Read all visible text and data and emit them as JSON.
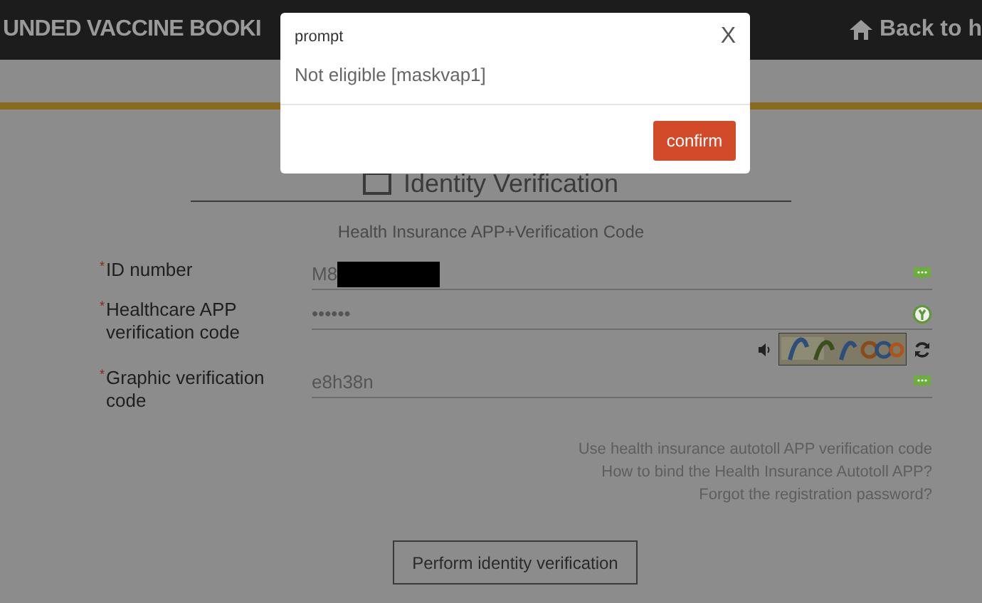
{
  "header": {
    "title": "UNDED VACCINE BOOKI",
    "back_link": "Back to h"
  },
  "form": {
    "heading": "Identity Verification",
    "subtitle": "Health Insurance APP+Verification Code",
    "fields": [
      {
        "kind": "id",
        "marker": "*",
        "label": "ID number",
        "value": "M8"
      },
      {
        "kind": "password",
        "marker": "*",
        "label": "Healthcare APP verification code",
        "value": "••••••"
      },
      {
        "kind": "captcha",
        "marker": "*",
        "label": "Graphic verification code",
        "value": "e8h38n"
      }
    ],
    "links": [
      "Use health insurance autotoll APP verification code",
      "How to bind the Health Insurance Autotoll APP?",
      "Forgot the registration password?"
    ],
    "submit": "Perform identity verification"
  },
  "modal": {
    "title": "prompt",
    "close": "X",
    "message": "Not eligible [maskvap1]",
    "button": "confirm"
  }
}
